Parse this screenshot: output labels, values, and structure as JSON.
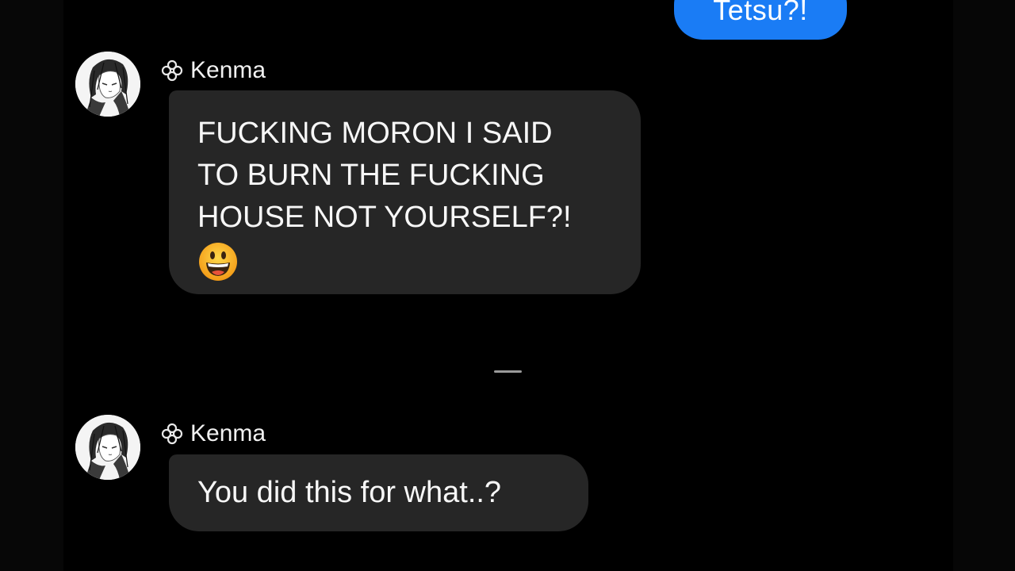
{
  "outgoing_message": {
    "text": "Tetsu?!",
    "color": "#1a7cf5"
  },
  "messages": [
    {
      "sender": "Kenma",
      "sender_icon": "clover-icon",
      "avatar": "kenma-avatar",
      "lines": [
        "FUCKING MORON I SAID",
        "TO BURN THE FUCKING",
        "HOUSE NOT YOURSELF?!"
      ],
      "emoji": "grinning-face-emoji"
    },
    {
      "sender": "Kenma",
      "sender_icon": "clover-icon",
      "avatar": "kenma-avatar",
      "lines": [
        "You did this for what..?"
      ]
    }
  ],
  "colors": {
    "background": "#000000",
    "incoming_bubble": "#262626",
    "text": "#f7f7f7"
  }
}
